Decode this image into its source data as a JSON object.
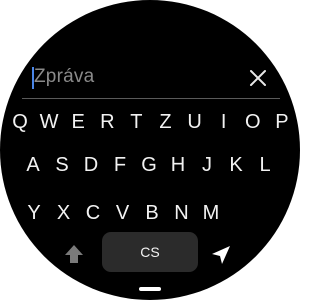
{
  "input": {
    "value": "Zpráva",
    "close_icon": "close-icon"
  },
  "keyboard": {
    "row1": [
      "Q",
      "W",
      "E",
      "R",
      "T",
      "Z",
      "U",
      "I",
      "O",
      "P"
    ],
    "row2": [
      "A",
      "S",
      "D",
      "F",
      "G",
      "H",
      "J",
      "K",
      "L"
    ],
    "row3": [
      "Y",
      "X",
      "C",
      "V",
      "B",
      "N",
      "M"
    ],
    "shift_icon": "shift-arrow-up-icon",
    "language_label": "CS",
    "send_icon": "send-icon"
  },
  "colors": {
    "background": "#000000",
    "key_text": "#f2f2f2",
    "placeholder_text": "#8a8a8a",
    "cursor": "#4a86e8",
    "language_button": "#2b2b2b"
  }
}
